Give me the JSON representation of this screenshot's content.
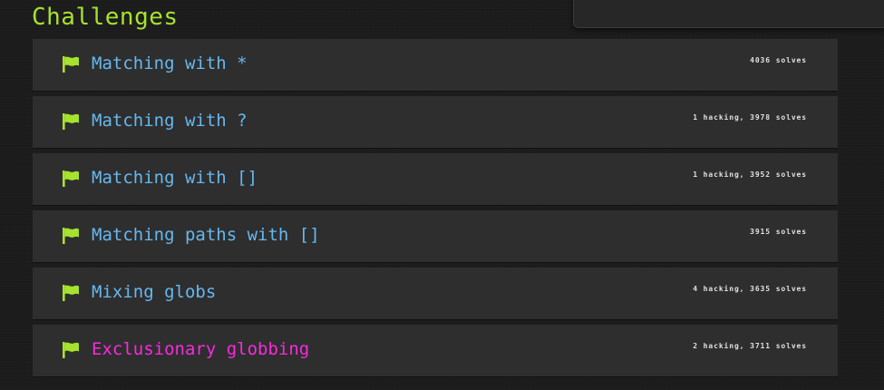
{
  "section": {
    "title": "Challenges"
  },
  "colors": {
    "title": "#a6e22e",
    "flag": "#a6e22e",
    "link": "#66b8f0",
    "active_link": "#f92adf",
    "row_bg": "#2e2e2e",
    "page_bg": "#1c1c1c"
  },
  "challenges": [
    {
      "name": "Matching with *",
      "stats": "4036 solves",
      "icon": "flag-icon",
      "active": false
    },
    {
      "name": "Matching with ?",
      "stats": "1 hacking, 3978 solves",
      "icon": "flag-icon",
      "active": false
    },
    {
      "name": "Matching with []",
      "stats": "1 hacking, 3952 solves",
      "icon": "flag-icon",
      "active": false
    },
    {
      "name": "Matching paths with []",
      "stats": "3915 solves",
      "icon": "flag-icon",
      "active": false
    },
    {
      "name": "Mixing globs",
      "stats": "4 hacking, 3635 solves",
      "icon": "flag-icon",
      "active": false
    },
    {
      "name": "Exclusionary globbing",
      "stats": "2 hacking, 3711 solves",
      "icon": "flag-icon",
      "active": true
    }
  ]
}
